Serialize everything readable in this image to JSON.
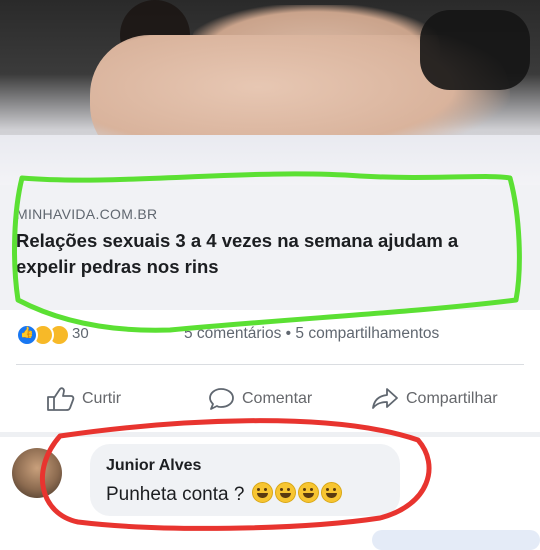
{
  "post": {
    "link": {
      "domain": "MINHAVIDA.COM.BR",
      "headline": "Relações sexuais 3 a 4 vezes na semana ajudam a expelir pedras nos rins"
    },
    "stats": {
      "reaction_count": "30",
      "comments_shares": "5 comentários • 5 compartilhamentos"
    },
    "actions": {
      "like": "Curtir",
      "comment": "Comentar",
      "share": "Compartilhar"
    }
  },
  "comment": {
    "author": "Junior Alves",
    "text": "Punheta conta ?",
    "emojis": [
      "grinning-face-with-sweat-icon",
      "grinning-face-with-sweat-icon",
      "grinning-face-with-sweat-icon",
      "grinning-face-with-sweat-icon"
    ]
  },
  "annotations": {
    "green_outline_color": "#5be033",
    "red_outline_color": "#e8342f"
  }
}
